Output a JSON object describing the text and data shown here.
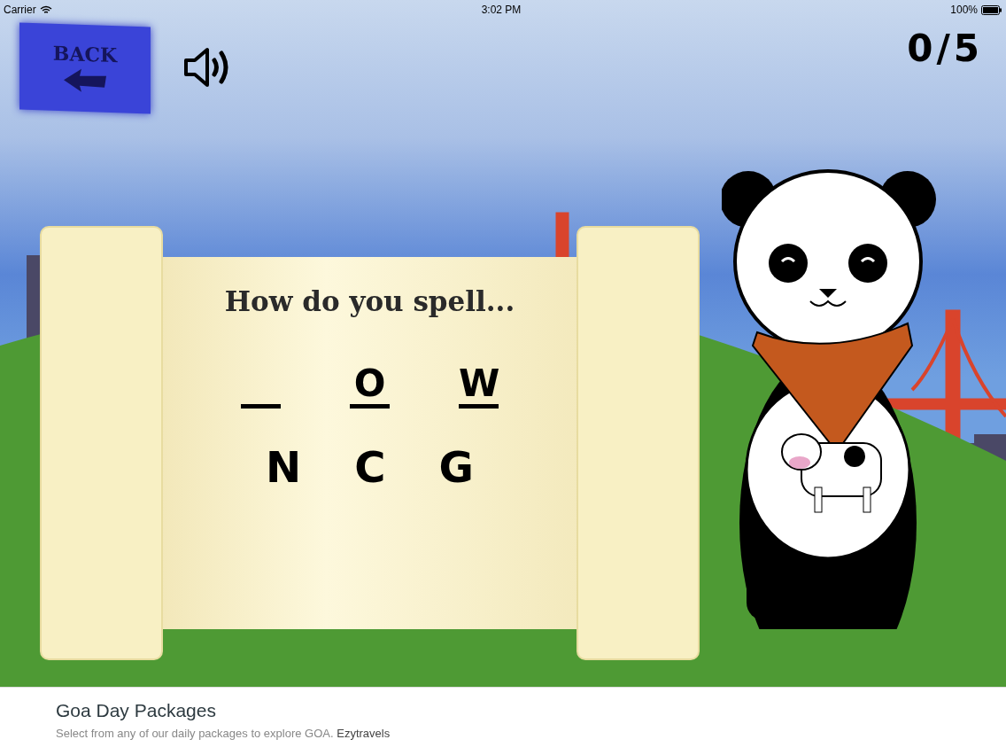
{
  "status_bar": {
    "carrier": "Carrier",
    "time": "3:02 PM",
    "battery": "100%"
  },
  "back_button": {
    "label": "BACK"
  },
  "score": "0/5",
  "prompt": "How do you spell...",
  "word_slots": [
    {
      "kind": "blank"
    },
    {
      "kind": "letter",
      "letter": "O"
    },
    {
      "kind": "letter",
      "letter": "W"
    }
  ],
  "letter_choices": [
    "N",
    "C",
    "G"
  ],
  "ad": {
    "title": "Goa Day Packages",
    "text": "Select from any of our daily packages to explore GOA.",
    "advertiser": "Ezytravels"
  }
}
